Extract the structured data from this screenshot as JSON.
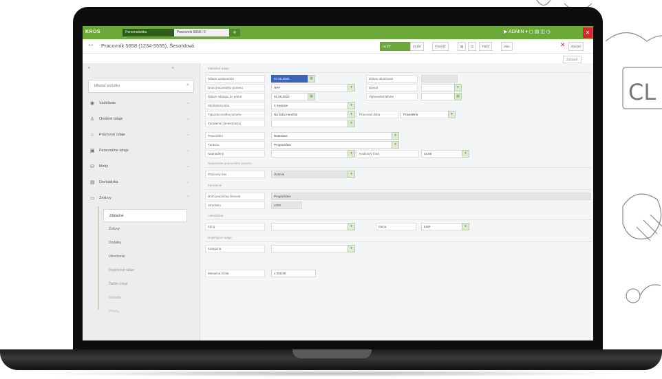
{
  "topbar": {
    "logo": "KROS",
    "module_tab": "Personalistika",
    "document_tab": "Pracovník 5658 / 0",
    "plus": "+",
    "right_user": "▶ ADMIN ▾ ◻ ▤ ◫ ◷",
    "close": "✕"
  },
  "titlebar": {
    "nav_arrows": "◂ ▸",
    "page_title": "Pracovník 5658 (1234-5555), Šesordová",
    "save": "Uložiť",
    "buttons": [
      "Zrušiť",
      "Potvrdiť",
      "▤",
      "◫",
      "Tlačiť",
      "Viac",
      "Zavrieť"
    ],
    "cancel_x": "✕",
    "secondary": "Zobraziť"
  },
  "sidebar": {
    "header_left": "▾",
    "header_right": "≡",
    "search_placeholder": "Hľadať položku",
    "search_icon": "⌕",
    "items": [
      {
        "label": "Vzdelanie",
        "icon": "◉"
      },
      {
        "label": "Osobné údaje",
        "icon": "♙"
      },
      {
        "label": "Pracovné údaje",
        "icon": "♘"
      },
      {
        "label": "Personálne údaje",
        "icon": "▣"
      },
      {
        "label": "Mzdy",
        "icon": "⛁"
      },
      {
        "label": "Dochádzka",
        "icon": "▤"
      },
      {
        "label": "Zmluvy",
        "icon": "▭"
      }
    ],
    "sub_items": [
      "Základné",
      "Zmluvy",
      "Dodatky",
      "Ukončenie",
      "Doplnkové údaje",
      "Ďalšie údaje",
      "Doklady",
      "Prílohy"
    ]
  },
  "form": {
    "sections": [
      "Základné údaje",
      "Nastavenie pracovného pomeru",
      "Zaradenie",
      "Lokalizácia",
      "Doplňujúce údaje"
    ],
    "fields": [
      {
        "label": "Dátum uzatvorenia",
        "value": "07.05.2020"
      },
      {
        "label": "Druh pracovného pomeru",
        "value": "HPP"
      },
      {
        "label": "Dátum nástupu do práce",
        "value": "01.06.2020"
      },
      {
        "label": "Skúšobná doba",
        "value": "3 mesiace"
      },
      {
        "label": "Typ pracovného pomeru",
        "value": "Na dobu neurčitú"
      },
      {
        "label": "Zaradenie zamestnanca",
        "value": ""
      },
      {
        "label": "Pracovisko",
        "value": "Bratislava"
      },
      {
        "label": "Funkcia",
        "value": "Programátor"
      },
      {
        "label": "Nadriadený",
        "value": ""
      },
      {
        "label": "Pracovný čas",
        "value": "Úväzok"
      },
      {
        "label": "Druh pracovnej činnosti",
        "value": "Programátor"
      },
      {
        "label": "Stredisko",
        "value": "1000"
      },
      {
        "label": "Zdroj",
        "value": ""
      },
      {
        "label": "Kategória",
        "value": ""
      },
      {
        "label": "Mesačná mzda",
        "value": "1 200,00"
      }
    ],
    "right_fields": [
      {
        "label": "Dátum ukončenia",
        "value": ""
      },
      {
        "label": "Dôvod",
        "value": ""
      },
      {
        "label": "Výpovedná lehota",
        "value": ""
      },
      {
        "label": "Pracovná doba",
        "value": "Pravidelná"
      },
      {
        "label": "Hodinový fond",
        "value": "40,00"
      },
      {
        "label": "Mena",
        "value": "EUR"
      }
    ],
    "dropdown_glyph": "▾",
    "calendar_glyph": "▦"
  }
}
